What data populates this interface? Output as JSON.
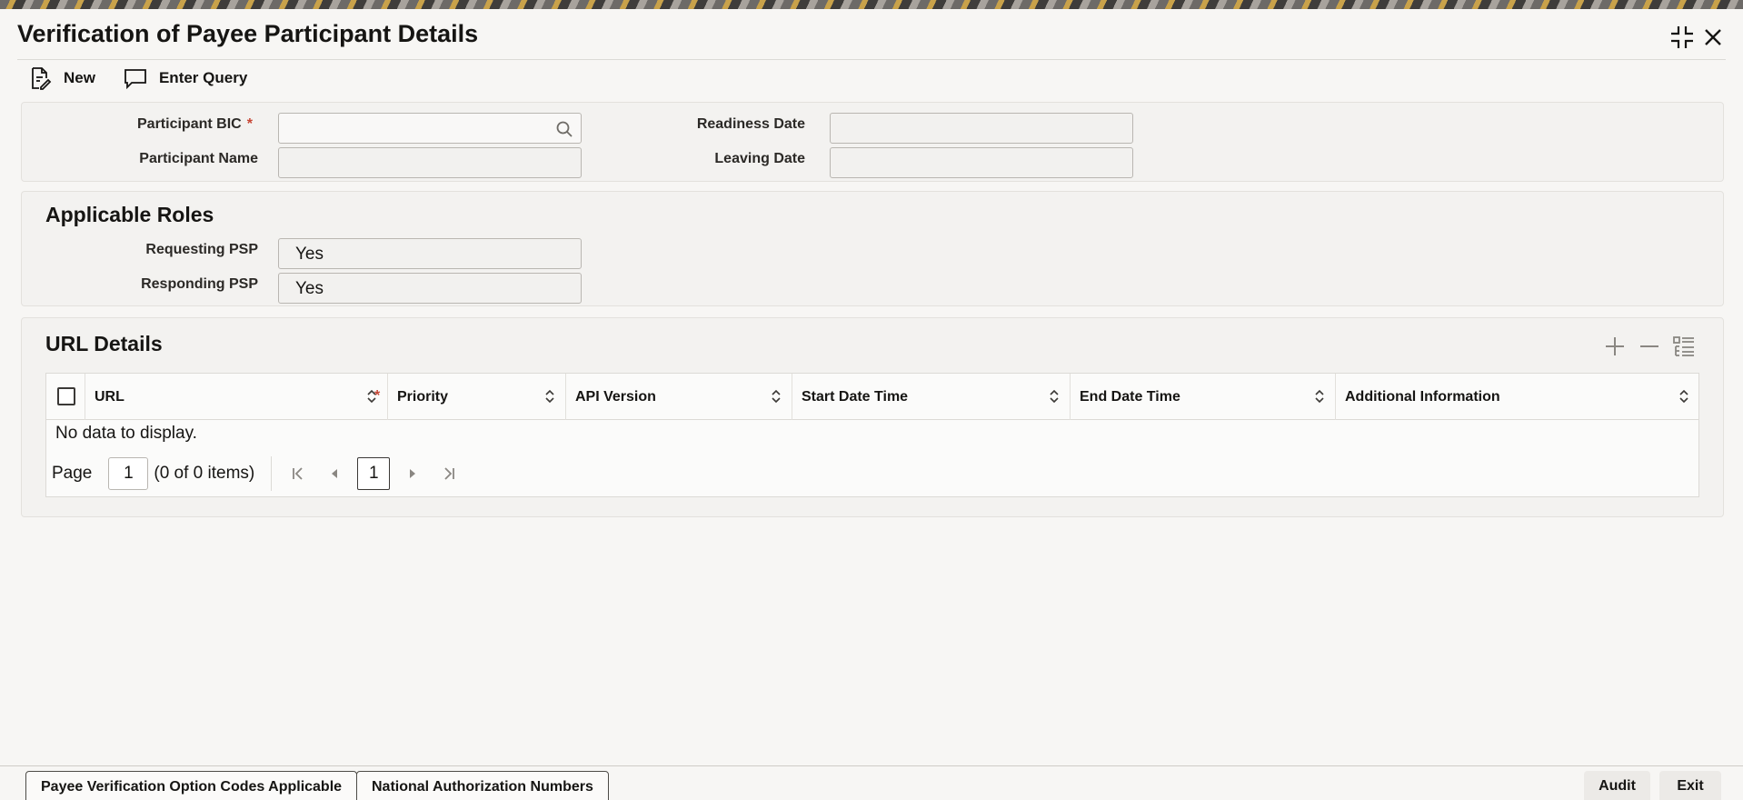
{
  "window": {
    "title": "Verification of Payee Participant Details"
  },
  "toolbar": {
    "new_label": "New",
    "enter_query_label": "Enter Query"
  },
  "participant": {
    "bic_label": "Participant BIC",
    "bic_required": "*",
    "bic_value": "",
    "name_label": "Participant Name",
    "name_value": "",
    "readiness_label": "Readiness Date",
    "readiness_value": "",
    "leaving_label": "Leaving Date",
    "leaving_value": ""
  },
  "roles": {
    "title": "Applicable Roles",
    "requesting_label": "Requesting PSP",
    "requesting_value": "Yes",
    "responding_label": "Responding PSP",
    "responding_value": "Yes"
  },
  "url_details": {
    "title": "URL Details",
    "columns": {
      "url": "URL",
      "url_required": "*",
      "priority": "Priority",
      "api_version": "API Version",
      "start": "Start Date Time",
      "end": "End Date Time",
      "additional": "Additional Information"
    },
    "empty_text": "No data to display.",
    "pager": {
      "page_label": "Page",
      "page_value": "1",
      "items_text": "(0 of 0 items)",
      "current_page": "1"
    }
  },
  "footer": {
    "option_codes_label": "Payee Verification Option Codes Applicable",
    "national_auth_label": "National Authorization Numbers",
    "audit_label": "Audit",
    "exit_label": "Exit"
  },
  "colors": {
    "required": "#c74634",
    "text": "#161513"
  }
}
